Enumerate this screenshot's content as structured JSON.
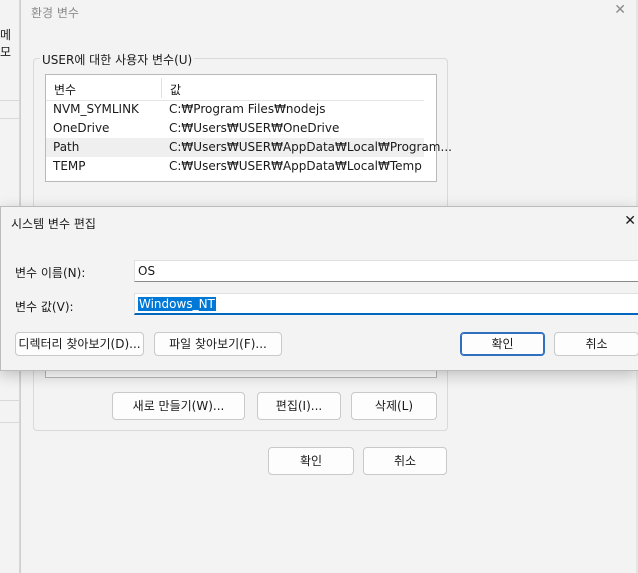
{
  "background": {
    "left_label": "메모"
  },
  "env_dialog": {
    "title": "환경 변수",
    "close_glyph": "✕",
    "user_group_label": "USER에 대한 사용자 변수(U)",
    "columns": {
      "name": "변수",
      "value": "값"
    },
    "rows": [
      {
        "name": "NVM_SYMLINK",
        "value": "C:₩Program Files₩nodejs"
      },
      {
        "name": "OneDrive",
        "value": "C:₩Users₩USER₩OneDrive"
      },
      {
        "name": "Path",
        "value": "C:₩Users₩USER₩AppData₩Local₩Program..."
      },
      {
        "name": "TEMP",
        "value": "C:₩Users₩USER₩AppData₩Local₩Temp"
      }
    ],
    "buttons": {
      "new": "새로 만들기(W)...",
      "edit": "편집(I)...",
      "delete": "삭제(L)"
    },
    "ok": "확인",
    "cancel": "취소"
  },
  "edit_dialog": {
    "title": "시스템 변수 편집",
    "close_glyph": "✕",
    "name_label": "변수 이름(N):",
    "name_value": "OS",
    "value_label": "변수 값(V):",
    "value_value": "Windows_NT",
    "browse_dir": "디렉터리 찾아보기(D)...",
    "browse_file": "파일 찾아보기(F)...",
    "ok": "확인",
    "cancel": "취소"
  },
  "colors": {
    "accent": "#0067c0",
    "selection": "#0078d7",
    "dialog_bg": "#f3f3f3"
  }
}
